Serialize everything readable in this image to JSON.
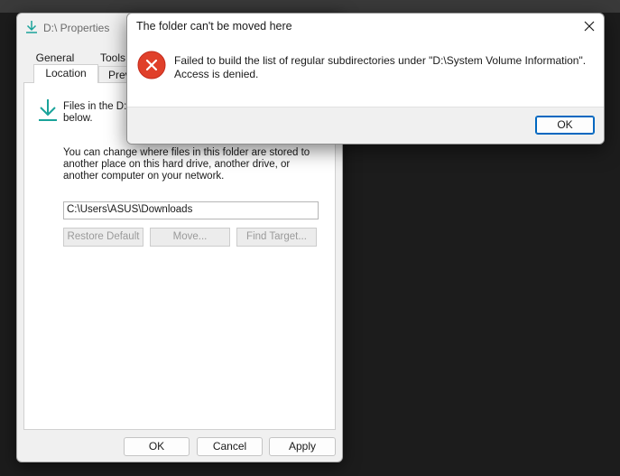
{
  "colors": {
    "desktop_bg": "#1c1c1c",
    "accent": "#0067c0",
    "error_red": "#c42b1c",
    "download_icon": "#1aa39a"
  },
  "properties_window": {
    "title": "D:\\ Properties",
    "title_icon": "download-arrow-icon",
    "tabs": {
      "general": "General",
      "tools": "Tools",
      "location": "Location",
      "previous": "Prev"
    },
    "files_text": "Files in the D:\\",
    "files_text_continued": "below.",
    "change_text": "You can change where files in this folder are stored to another place on this hard drive, another drive, or another computer on your network.",
    "path_value": "C:\\Users\\ASUS\\Downloads",
    "buttons": {
      "restore": "Restore Default",
      "move": "Move...",
      "find_target": "Find Target..."
    },
    "footer": {
      "ok": "OK",
      "cancel": "Cancel",
      "apply": "Apply"
    }
  },
  "error_dialog": {
    "title": "The folder can't be moved here",
    "icon": "error-x-icon",
    "message": "Failed to build the list of regular subdirectories under \"D:\\System Volume Information\". Access is denied.",
    "ok_label": "OK"
  }
}
